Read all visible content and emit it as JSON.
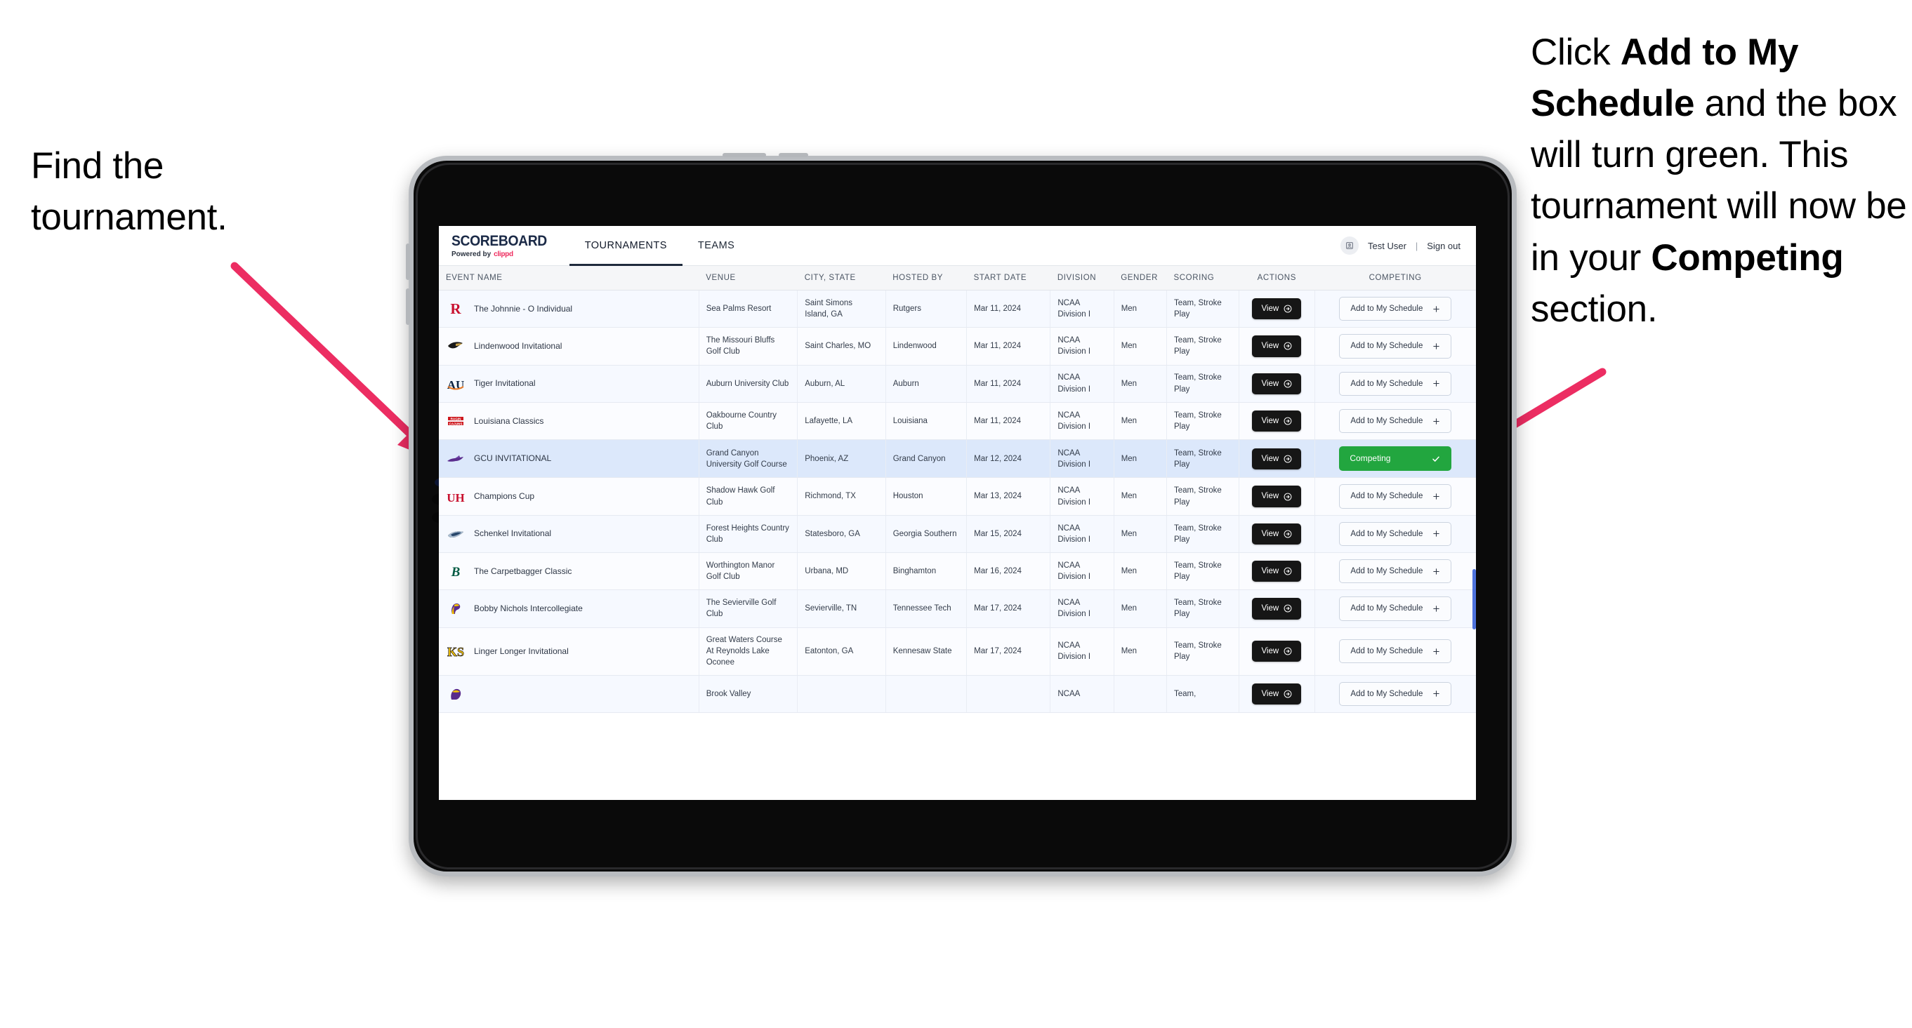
{
  "annotations": {
    "left": {
      "segments": [
        {
          "text": "Find the tournament.",
          "bold": false
        }
      ]
    },
    "right": {
      "segments": [
        {
          "text": "Click ",
          "bold": false
        },
        {
          "text": "Add to My Schedule",
          "bold": true
        },
        {
          "text": " and the box will turn green. This tournament will now be in your ",
          "bold": false
        },
        {
          "text": "Competing",
          "bold": true
        },
        {
          "text": " section.",
          "bold": false
        }
      ]
    }
  },
  "app": {
    "brand": {
      "title": "SCOREBOARD",
      "powered_prefix": "Powered by",
      "powered_name": "clippd"
    },
    "nav": {
      "tabs": [
        {
          "label": "TOURNAMENTS",
          "active": true
        },
        {
          "label": "TEAMS",
          "active": false
        }
      ]
    },
    "user": {
      "avatar_icon": "user-badge-icon",
      "name": "Test User",
      "separator": "|",
      "signout": "Sign out"
    },
    "table": {
      "columns": [
        "EVENT NAME",
        "VENUE",
        "CITY, STATE",
        "HOSTED BY",
        "START DATE",
        "DIVISION",
        "GENDER",
        "SCORING",
        "ACTIONS",
        "COMPETING"
      ],
      "action_label": "View",
      "add_label": "Add to My Schedule",
      "add_icon": "plus-icon",
      "competing_label": "Competing",
      "competing_icon": "check-icon",
      "competing_color": "#22a63f",
      "rows": [
        {
          "logo": "rutgers-r-logo",
          "event": "The Johnnie - O Individual",
          "venue": "Sea Palms Resort",
          "city": "Saint Simons Island, GA",
          "host": "Rutgers",
          "date": "Mar 11, 2024",
          "division": "NCAA Division I",
          "gender": "Men",
          "scoring": "Team, Stroke Play",
          "competing": false
        },
        {
          "logo": "lindenwood-lion-logo",
          "event": "Lindenwood Invitational",
          "venue": "The Missouri Bluffs Golf Club",
          "city": "Saint Charles, MO",
          "host": "Lindenwood",
          "date": "Mar 11, 2024",
          "division": "NCAA Division I",
          "gender": "Men",
          "scoring": "Team, Stroke Play",
          "competing": false
        },
        {
          "logo": "auburn-au-logo",
          "event": "Tiger Invitational",
          "venue": "Auburn University Club",
          "city": "Auburn, AL",
          "host": "Auburn",
          "date": "Mar 11, 2024",
          "division": "NCAA Division I",
          "gender": "Men",
          "scoring": "Team, Stroke Play",
          "competing": false
        },
        {
          "logo": "louisiana-ragin-cajuns-logo",
          "event": "Louisiana Classics",
          "venue": "Oakbourne Country Club",
          "city": "Lafayette, LA",
          "host": "Louisiana",
          "date": "Mar 11, 2024",
          "division": "NCAA Division I",
          "gender": "Men",
          "scoring": "Team, Stroke Play",
          "competing": false
        },
        {
          "logo": "grand-canyon-lope-logo",
          "event": "GCU INVITATIONAL",
          "venue": "Grand Canyon University Golf Course",
          "city": "Phoenix, AZ",
          "host": "Grand Canyon",
          "date": "Mar 12, 2024",
          "division": "NCAA Division I",
          "gender": "Men",
          "scoring": "Team, Stroke Play",
          "competing": true
        },
        {
          "logo": "houston-uh-logo",
          "event": "Champions Cup",
          "venue": "Shadow Hawk Golf Club",
          "city": "Richmond, TX",
          "host": "Houston",
          "date": "Mar 13, 2024",
          "division": "NCAA Division I",
          "gender": "Men",
          "scoring": "Team, Stroke Play",
          "competing": false
        },
        {
          "logo": "georgia-southern-eagle-logo",
          "event": "Schenkel Invitational",
          "venue": "Forest Heights Country Club",
          "city": "Statesboro, GA",
          "host": "Georgia Southern",
          "date": "Mar 15, 2024",
          "division": "NCAA Division I",
          "gender": "Men",
          "scoring": "Team, Stroke Play",
          "competing": false
        },
        {
          "logo": "binghamton-b-logo",
          "event": "The Carpetbagger Classic",
          "venue": "Worthington Manor Golf Club",
          "city": "Urbana, MD",
          "host": "Binghamton",
          "date": "Mar 16, 2024",
          "division": "NCAA Division I",
          "gender": "Men",
          "scoring": "Team, Stroke Play",
          "competing": false
        },
        {
          "logo": "tennessee-tech-eagle-logo",
          "event": "Bobby Nichols Intercollegiate",
          "venue": "The Sevierville Golf Club",
          "city": "Sevierville, TN",
          "host": "Tennessee Tech",
          "date": "Mar 17, 2024",
          "division": "NCAA Division I",
          "gender": "Men",
          "scoring": "Team, Stroke Play",
          "competing": false
        },
        {
          "logo": "kennesaw-state-ks-logo",
          "event": "Linger Longer Invitational",
          "venue": "Great Waters Course At Reynolds Lake Oconee",
          "city": "Eatonton, GA",
          "host": "Kennesaw State",
          "date": "Mar 17, 2024",
          "division": "NCAA Division I",
          "gender": "Men",
          "scoring": "Team, Stroke Play",
          "competing": false
        },
        {
          "logo": "east-carolina-pirate-logo",
          "event": "",
          "venue": "Brook Valley",
          "city": "",
          "host": "",
          "date": "",
          "division": "NCAA",
          "gender": "",
          "scoring": "Team,",
          "competing": false
        }
      ]
    }
  }
}
